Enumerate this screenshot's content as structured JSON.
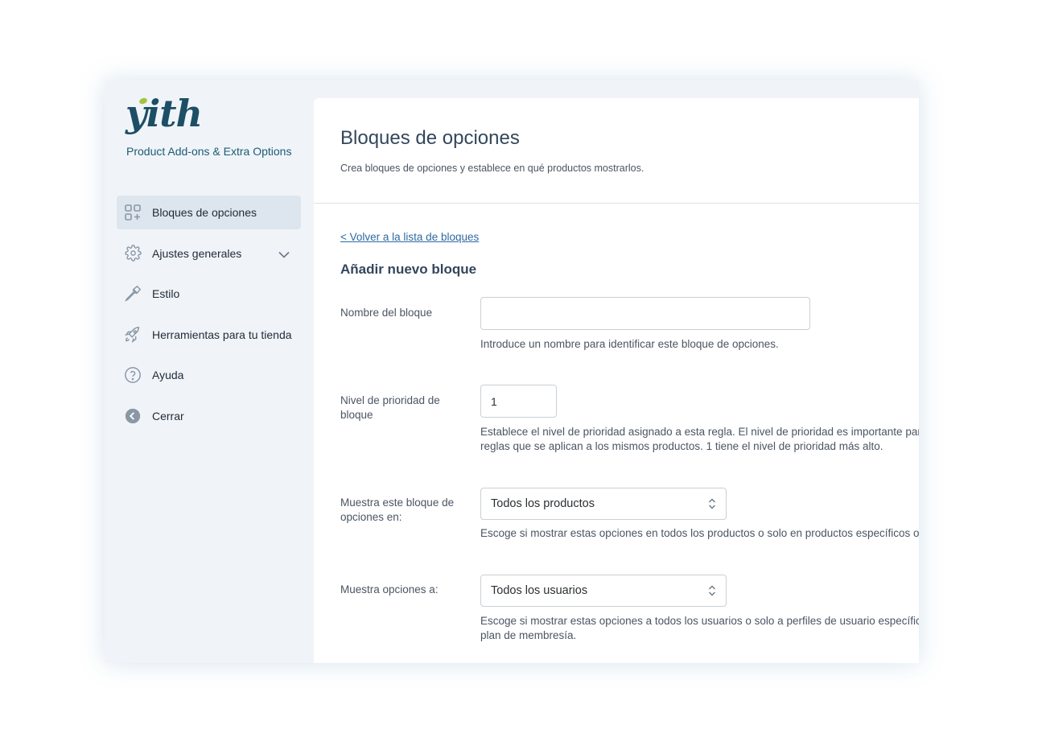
{
  "brand": {
    "logo_text": "yith",
    "product_name": "Product Add-ons & Extra Options"
  },
  "sidebar": {
    "items": [
      {
        "label": "Bloques de opciones",
        "icon": "blocks-add-icon",
        "active": true
      },
      {
        "label": "Ajustes generales",
        "icon": "gear-icon",
        "expandable": true
      },
      {
        "label": "Estilo",
        "icon": "eyedropper-icon"
      },
      {
        "label": "Herramientas para tu tienda",
        "icon": "rocket-icon"
      },
      {
        "label": "Ayuda",
        "icon": "question-circle-icon"
      },
      {
        "label": "Cerrar",
        "icon": "back-arrow-circle-icon"
      }
    ]
  },
  "header": {
    "title": "Bloques de opciones",
    "subtitle": "Crea bloques de opciones y establece en qué productos mostrarlos."
  },
  "content": {
    "back_link": "< Volver a la lista de bloques",
    "section_title": "Añadir nuevo bloque",
    "fields": {
      "name": {
        "label": "Nombre del bloque",
        "value": "",
        "help": "Introduce un nombre para identificar este bloque de opciones."
      },
      "priority": {
        "label": "Nivel de prioridad de bloque",
        "value": "1",
        "help_line1": "Establece el nivel de prioridad asignado a esta regla. El nivel de prioridad es importante para",
        "help_line2": "reglas que se aplican a los mismos productos. 1 tiene el nivel de prioridad más alto."
      },
      "show_on": {
        "label": "Muestra este bloque de opciones en:",
        "selected": "Todos los productos",
        "help": "Escoge si mostrar estas opciones en todos los productos o solo en productos específicos o ca"
      },
      "show_to": {
        "label": "Muestra opciones a:",
        "selected": "Todos los usuarios",
        "help_line1": "Escoge si mostrar estas opciones a todos los usuarios o solo a perfiles de usuario específicos",
        "help_line2": "plan de membresía."
      }
    }
  },
  "colors": {
    "sidebar_bg": "#f0f4f8",
    "active_item_bg": "#dde6ee",
    "brand_text": "#1c5b75",
    "logo_dot": "#a3c43b",
    "link": "#2c6aa0"
  }
}
